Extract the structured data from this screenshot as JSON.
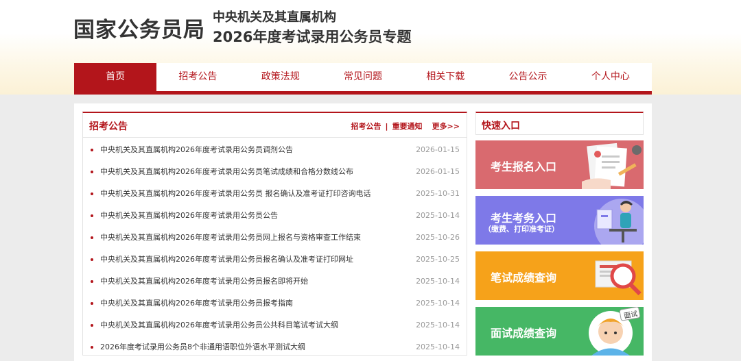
{
  "header": {
    "title": "国家公务员局",
    "subtitle_line1": "中央机关及其直属机构",
    "subtitle_line2": "2026年度考试录用公务员专题"
  },
  "nav": {
    "items": [
      {
        "label": "首页",
        "active": true
      },
      {
        "label": "招考公告",
        "active": false
      },
      {
        "label": "政策法规",
        "active": false
      },
      {
        "label": "常见问题",
        "active": false
      },
      {
        "label": "相关下载",
        "active": false
      },
      {
        "label": "公告公示",
        "active": false
      },
      {
        "label": "个人中心",
        "active": false
      }
    ]
  },
  "news": {
    "title": "招考公告",
    "link_announcements": "招考公告",
    "separator": "|",
    "link_important": "重要通知",
    "link_more": "更多>>",
    "items": [
      {
        "title": "中央机关及其直属机构2026年度考试录用公务员调剂公告",
        "date": "2026-01-15"
      },
      {
        "title": "中央机关及其直属机构2026年度考试录用公务员笔试成绩和合格分数线公布",
        "date": "2026-01-15"
      },
      {
        "title": "中央机关及其直属机构2026年度考试录用公务员 报名确认及准考证打印咨询电话",
        "date": "2025-10-31"
      },
      {
        "title": "中央机关及其直属机构2026年度考试录用公务员公告",
        "date": "2025-10-14"
      },
      {
        "title": "中央机关及其直属机构2026年度考试录用公务员网上报名与资格审查工作结束",
        "date": "2025-10-26"
      },
      {
        "title": "中央机关及其直属机构2026年度考试录用公务员报名确认及准考证打印网址",
        "date": "2025-10-25"
      },
      {
        "title": "中央机关及其直属机构2026年度考试录用公务员报名即将开始",
        "date": "2025-10-14"
      },
      {
        "title": "中央机关及其直属机构2026年度考试录用公务员报考指南",
        "date": "2025-10-14"
      },
      {
        "title": "中央机关及其直属机构2026年度考试录用公务员公共科目笔试考试大纲",
        "date": "2025-10-14"
      },
      {
        "title": "2026年度考试录用公务员8个非通用语职位外语水平测试大纲",
        "date": "2025-10-14"
      }
    ]
  },
  "quick": {
    "title": "快速入口",
    "tiles": [
      {
        "label": "考生报名入口",
        "sublabel": "",
        "icon": "application-form-icon",
        "color": "#d96a6f"
      },
      {
        "label": "考生考务入口",
        "sublabel": "（缴费、打印准考证）",
        "icon": "person-at-computer-icon",
        "color": "#7e79e8"
      },
      {
        "label": "笔试成绩查询",
        "sublabel": "",
        "icon": "magnifier-icon",
        "color": "#f6a21a"
      },
      {
        "label": "面试成绩查询",
        "sublabel": "",
        "icon": "interview-person-icon",
        "color": "#46b765",
        "badge": "面试"
      }
    ]
  }
}
